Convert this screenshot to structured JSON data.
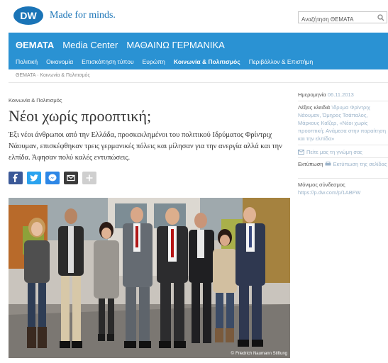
{
  "header": {
    "slogan": "Made for minds.",
    "search": {
      "value": "Αναζήτηση ΘΕΜΑΤΑ"
    }
  },
  "nav": {
    "main": [
      {
        "label": "ΘΕΜΑΤΑ",
        "active": true
      },
      {
        "label": "Media Center"
      },
      {
        "label": "ΜΑΘΑΙΝΩ ΓΕΡΜΑΝΙΚΑ"
      }
    ],
    "sub": [
      {
        "label": "Πολιτική"
      },
      {
        "label": "Οικονομία"
      },
      {
        "label": "Επισκόπηση τύπου"
      },
      {
        "label": "Ευρώπη"
      },
      {
        "label": "Κοινωνία & Πολιτισμός",
        "active": true
      },
      {
        "label": "Περιβάλλον & Επιστήμη"
      }
    ]
  },
  "breadcrumb": "ΘΕΜΑΤΑ · Κοινωνία & Πολιτισμός",
  "article": {
    "category": "Κοινωνία & Πολιτισμός",
    "headline": "Νέοι χωρίς προοπτική;",
    "lead": "Έξι νέοι άνθρωποι από την Ελλάδα, προσκεκλημένοι του πολιτικού Ιδρύματος Φρίντριχ Νάουμαν, επισκέφθηκαν τρεις γερμανικές πόλεις και μίλησαν για την ανεργία αλλά και την ελπίδα. Άφησαν πολύ καλές εντυπώσεις.",
    "photo_credit": "Friedrich Naumann Stiftung"
  },
  "social": [
    "facebook-icon",
    "twitter-icon",
    "messenger-icon",
    "mail-icon",
    "plus-icon"
  ],
  "sidebar": {
    "date_label": "Ημερομηνία",
    "date_value": "06.11.2013",
    "keywords_label": "Λέξεις κλειδιά",
    "keywords_value": "Ίδρυμα Φρίντριχ Νάουμαν, Όμηρος Τσάπαλος, Μάρκους Καΐζερ, «Νέοι χωρίς προοπτική; Ανάμεσα στην παραίτηση και την ελπίδα»",
    "feedback": "Πείτε μας τη γνώμη σας",
    "print_label": "Εκτύπωση",
    "print_link": "Εκτύπωση της σελίδας",
    "permalink_label": "Μόνιμος σύνδεσμος",
    "permalink_value": "https://p.dw.com/p/1ABFW"
  },
  "colors": {
    "nav": "#2a92d3",
    "brand": "#1a74b7",
    "link": "#9bb3c9"
  }
}
